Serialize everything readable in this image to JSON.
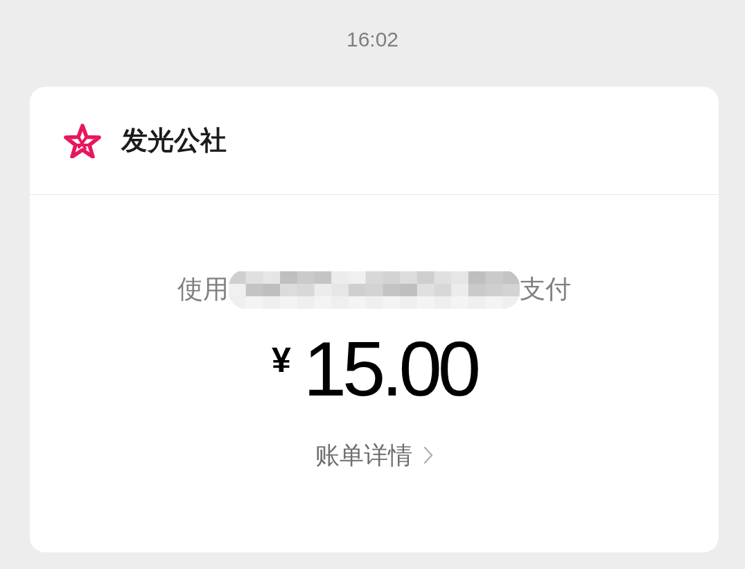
{
  "status": {
    "time": "16:02"
  },
  "merchant": {
    "name": "发光公社"
  },
  "payment": {
    "method_prefix": "使用",
    "method_suffix": "支付",
    "currency": "¥",
    "amount": "15.00"
  },
  "link": {
    "label": "账单详情"
  }
}
